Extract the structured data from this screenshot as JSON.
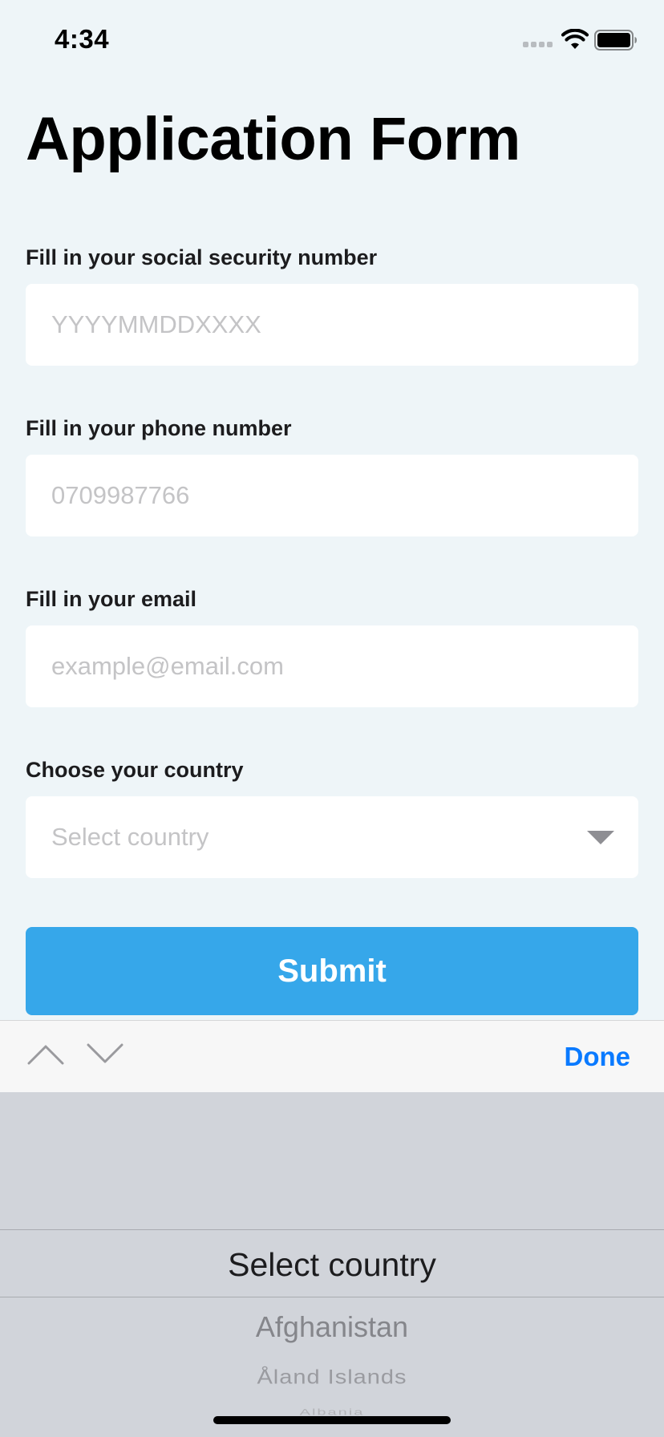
{
  "status_bar": {
    "time": "4:34"
  },
  "page": {
    "title": "Application Form"
  },
  "form": {
    "ssn": {
      "label": "Fill in your social security number",
      "placeholder": "YYYYMMDDXXXX",
      "value": ""
    },
    "phone": {
      "label": "Fill in your phone number",
      "placeholder": "0709987766",
      "value": ""
    },
    "email": {
      "label": "Fill in your email",
      "placeholder": "example@email.com",
      "value": ""
    },
    "country": {
      "label": "Choose your country",
      "placeholder": "Select country",
      "icon": "chevron-down-icon"
    },
    "submit_label": "Submit"
  },
  "accessory_bar": {
    "prev_icon": "chevron-up-icon",
    "next_icon": "chevron-down-icon",
    "done_label": "Done",
    "accent_color": "#0a7aff"
  },
  "picker": {
    "selected": "Select country",
    "options": [
      "Afghanistan",
      "Åland Islands",
      "Albania"
    ]
  },
  "colors": {
    "background": "#eef5f8",
    "submit": "#36a7ea",
    "picker_background": "#d1d4da"
  }
}
